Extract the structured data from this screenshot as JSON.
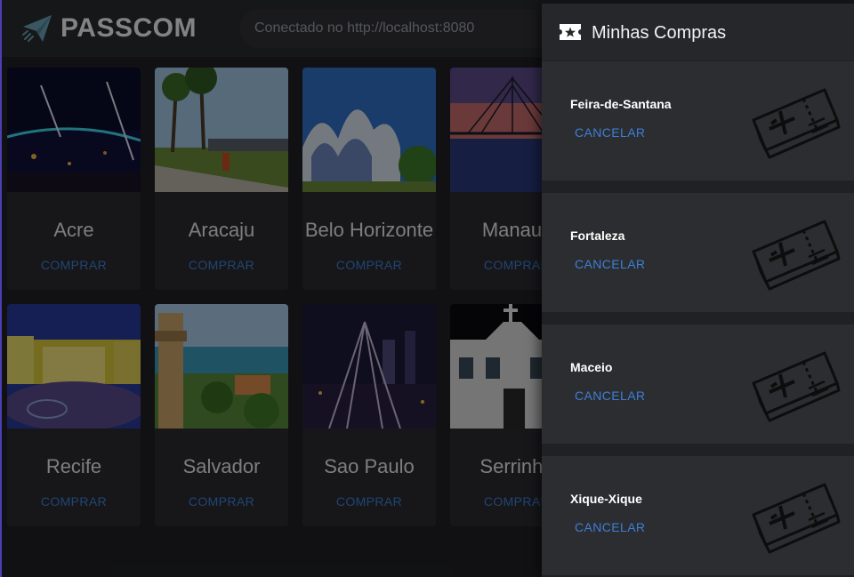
{
  "app": {
    "name": "PASSCOM",
    "status_text": "Conectado no http://localhost:8080"
  },
  "destinations": [
    {
      "name": "Acre",
      "action": "COMPRAR"
    },
    {
      "name": "Aracaju",
      "action": "COMPRAR"
    },
    {
      "name": "Belo Horizonte",
      "action": "COMPRAR"
    },
    {
      "name": "Manaus",
      "action": "COMPRAR"
    },
    {
      "name": "Recife",
      "action": "COMPRAR"
    },
    {
      "name": "Salvador",
      "action": "COMPRAR"
    },
    {
      "name": "Sao Paulo",
      "action": "COMPRAR"
    },
    {
      "name": "Serrinha",
      "action": "COMPRAR"
    }
  ],
  "drawer": {
    "icon": "ticket-star-icon",
    "title": "Minhas Compras",
    "purchases": [
      {
        "city": "Feira-de-Santana",
        "action": "CANCELAR",
        "icon": "plane-ticket-icon"
      },
      {
        "city": "Fortaleza",
        "action": "CANCELAR",
        "icon": "plane-ticket-icon"
      },
      {
        "city": "Maceio",
        "action": "CANCELAR",
        "icon": "plane-ticket-icon"
      },
      {
        "city": "Xique-Xique",
        "action": "CANCELAR",
        "icon": "plane-ticket-icon"
      }
    ]
  },
  "colors": {
    "background": "#202124",
    "card": "#2b2c30",
    "accent_link": "#3d7fd6",
    "drawer_card": "#2c2d31"
  }
}
